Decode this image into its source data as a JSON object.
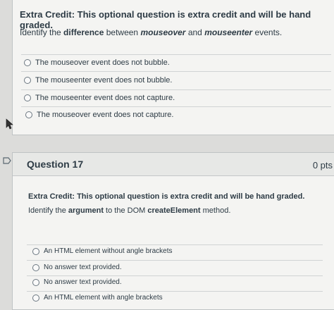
{
  "top": {
    "title": "Extra Credit: This optional question is extra credit and will be hand graded.",
    "prompt_pre": "Identify the ",
    "prompt_em": "difference",
    "prompt_mid": " between ",
    "prompt_a": "mouseover",
    "prompt_and": " and ",
    "prompt_b": "mouseenter",
    "prompt_post": " events.",
    "options": [
      "The mouseover event does not bubble.",
      "The mouseenter event does not bubble.",
      "The mouseenter event does not capture.",
      "The mouseover event does not capture."
    ]
  },
  "question17": {
    "label": "Question 17",
    "points": "0 pts",
    "title": "Extra Credit: This optional question is extra credit and will be hand graded.",
    "prompt_pre": "Identify the ",
    "prompt_em": "argument",
    "prompt_mid": " to the DOM ",
    "prompt_b": "createElement",
    "prompt_post": " method.",
    "options": [
      "An HTML element without angle brackets",
      "No answer text provided.",
      "No answer text provided.",
      "An HTML element with angle brackets"
    ]
  }
}
